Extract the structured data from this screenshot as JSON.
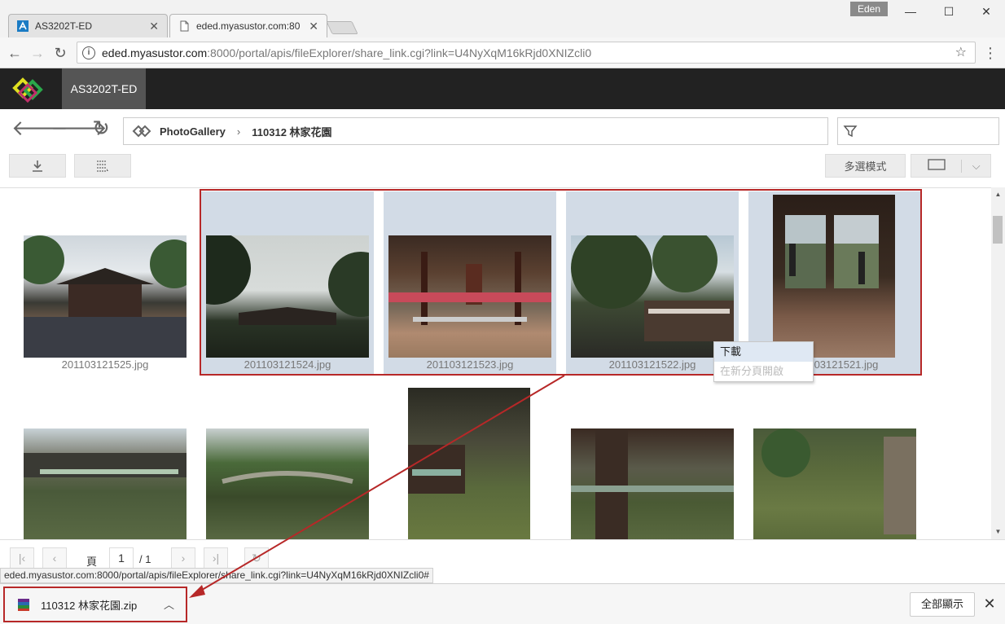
{
  "browser": {
    "tabs": [
      {
        "title": "AS3202T-ED",
        "active": false
      },
      {
        "title": "eded.myasustor.com:80",
        "active": true
      }
    ],
    "profile_name": "Eden",
    "window_controls": {
      "minimize": "—",
      "maximize": "☐",
      "close": "✕"
    },
    "address": {
      "host": "eded.myasustor.com",
      "path": ":8000/portal/apis/fileExplorer/share_link.cgi?link=U4NyXqM16kRjd0XNIZcli0"
    }
  },
  "app": {
    "device_name": "AS3202T-ED",
    "breadcrumb": {
      "root": "PhotoGallery",
      "separator": "›",
      "folder": "110312 林家花園"
    },
    "toolbar": {
      "multi_select_label": "多選模式"
    }
  },
  "gallery": {
    "row1": [
      {
        "filename": "201103121525.jpg",
        "selected": false,
        "orientation": "landscape"
      },
      {
        "filename": "201103121524.jpg",
        "selected": true,
        "orientation": "landscape"
      },
      {
        "filename": "201103121523.jpg",
        "selected": true,
        "orientation": "landscape"
      },
      {
        "filename": "201103121522.jpg",
        "selected": true,
        "orientation": "landscape"
      },
      {
        "filename": "201103121521.jpg",
        "selected": true,
        "orientation": "portrait"
      }
    ],
    "row2_count": 5
  },
  "context_menu": {
    "items": [
      {
        "label": "下載",
        "highlighted": true
      },
      {
        "label": "在新分頁開啟",
        "highlighted": false
      }
    ]
  },
  "pager": {
    "page_label": "頁",
    "current_page": "1",
    "total": "/ 1"
  },
  "status_url": "eded.myasustor.com:8000/portal/apis/fileExplorer/share_link.cgi?link=U4NyXqM16kRjd0XNIZcli0#",
  "download_shelf": {
    "file_name": "110312 林家花園.zip",
    "show_all_label": "全部顯示"
  },
  "colors": {
    "accent_red": "#b72828",
    "selection_bg": "#d2dbe6",
    "header_bg": "#222222"
  }
}
